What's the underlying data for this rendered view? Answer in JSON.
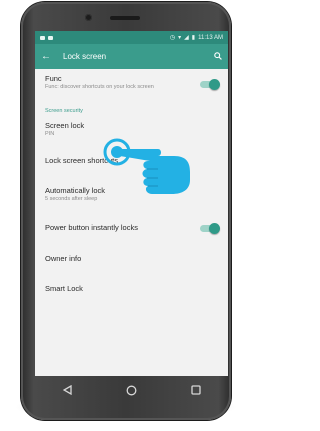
{
  "status_bar": {
    "time": "11:13 AM",
    "icons": [
      "notification-icon",
      "image-icon",
      "alarm-icon",
      "wifi-icon",
      "signal-icon",
      "battery-icon"
    ]
  },
  "app_bar": {
    "title": "Lock screen",
    "back_icon": "arrow-back-icon",
    "search_icon": "search-icon"
  },
  "items": {
    "func": {
      "label": "Func",
      "subtitle": "Func: discover shortcuts on your lock screen",
      "toggle_on": true
    },
    "section_header": "Screen security",
    "screen_lock": {
      "label": "Screen lock",
      "subtitle": "PIN"
    },
    "shortcuts": {
      "label": "Lock screen shortcuts"
    },
    "auto_lock": {
      "label": "Automatically lock",
      "subtitle": "5 seconds after sleep"
    },
    "power_lock": {
      "label": "Power button instantly locks",
      "toggle_on": true
    },
    "owner_info": {
      "label": "Owner info"
    },
    "smart_lock": {
      "label": "Smart Lock"
    }
  },
  "nav_bar": {
    "back": "nav-back-icon",
    "home": "nav-home-icon",
    "recents": "nav-recents-icon"
  },
  "colors": {
    "accent": "#3a9c8c",
    "status_bar": "#2d8a7b",
    "toggle_knob": "#2f9a88",
    "hand": "#23b1e4",
    "screen_bg": "#f2f2f2",
    "device": "#3a3a3a"
  }
}
